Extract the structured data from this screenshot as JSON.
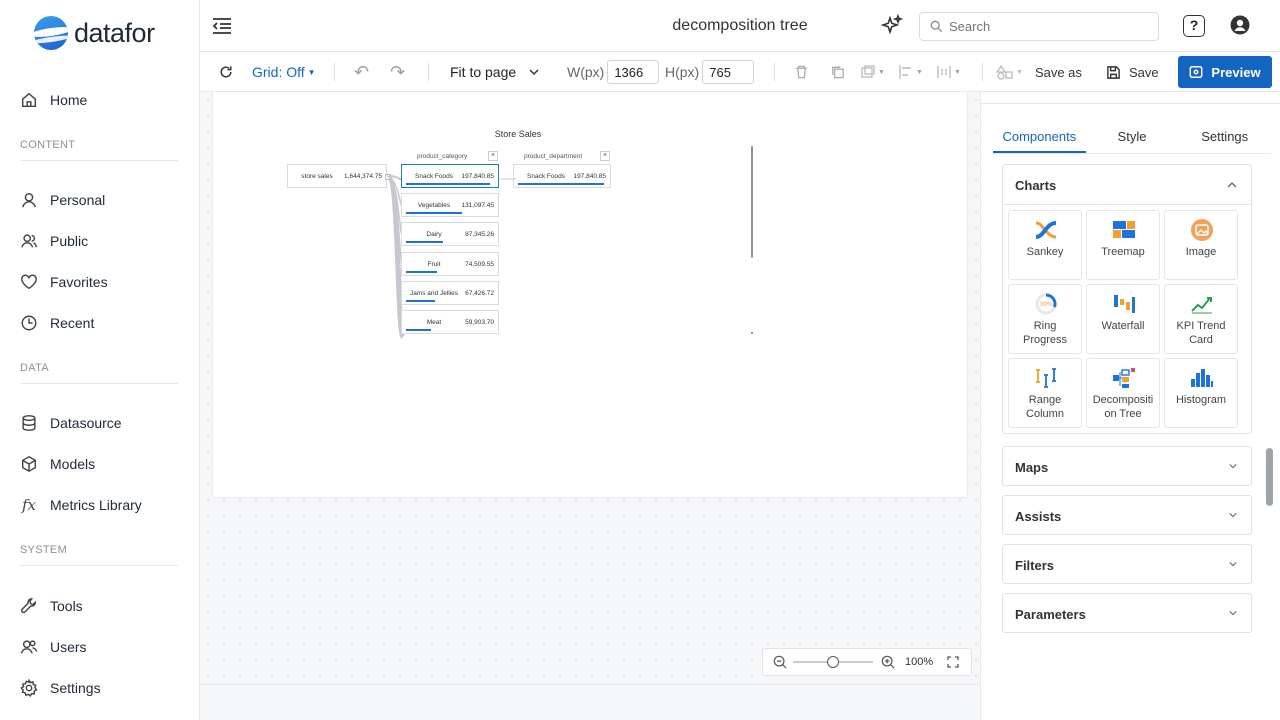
{
  "brand": {
    "name": "datafor"
  },
  "sidebar": {
    "items": [
      {
        "label": "Home",
        "icon": "home-icon"
      },
      {
        "label": "Personal",
        "icon": "user-icon"
      },
      {
        "label": "Public",
        "icon": "users-icon"
      },
      {
        "label": "Favorites",
        "icon": "heart-icon"
      },
      {
        "label": "Recent",
        "icon": "clock-icon"
      },
      {
        "label": "Datasource",
        "icon": "database-icon"
      },
      {
        "label": "Models",
        "icon": "cube-icon"
      },
      {
        "label": "Metrics Library",
        "icon": "fx-icon"
      },
      {
        "label": "Tools",
        "icon": "wrench-icon"
      },
      {
        "label": "Users",
        "icon": "people-icon"
      },
      {
        "label": "Settings",
        "icon": "gear-icon"
      }
    ],
    "sections": {
      "content": "CONTENT",
      "data": "DATA",
      "system": "SYSTEM"
    }
  },
  "header": {
    "title": "decomposition tree",
    "search_placeholder": "Search"
  },
  "toolbar": {
    "grid": "Grid: Off",
    "fit": "Fit to page",
    "w_label": "W(px)",
    "w_value": "1366",
    "h_label": "H(px)",
    "h_value": "765",
    "save_as": "Save as",
    "save": "Save",
    "preview": "Preview"
  },
  "canvas": {
    "zoom": "100%"
  },
  "chart": {
    "title": "Store Sales",
    "root": {
      "name": "store sales",
      "value": "1,644,374.75"
    },
    "level1_header": "product_category",
    "level2_header": "product_department",
    "level1": [
      {
        "name": "Snack Foods",
        "value": "197,840.85",
        "share": 0.93
      },
      {
        "name": "Vegetables",
        "value": "131,097.45",
        "share": 0.62
      },
      {
        "name": "Dairy",
        "value": "87,345.26",
        "share": 0.41
      },
      {
        "name": "Fruit",
        "value": "74,509.55",
        "share": 0.35
      },
      {
        "name": "Jams and Jellies",
        "value": "67,426.72",
        "share": 0.32
      },
      {
        "name": "Meat",
        "value": "59,903.70",
        "share": 0.28
      }
    ],
    "level2": [
      {
        "name": "Snack Foods",
        "value": "197,840.85",
        "share": 0.96
      }
    ]
  },
  "panel": {
    "tabs": [
      "Components",
      "Style",
      "Settings"
    ],
    "groups": {
      "charts": "Charts",
      "maps": "Maps",
      "assists": "Assists",
      "filters": "Filters",
      "parameters": "Parameters"
    },
    "components": [
      {
        "label": "Sankey",
        "icon": "sankey-icon"
      },
      {
        "label": "Treemap",
        "icon": "treemap-icon"
      },
      {
        "label": "Image",
        "icon": "image-icon"
      },
      {
        "label": "Ring Progress",
        "icon": "ring-progress-icon",
        "ring_text": "30%"
      },
      {
        "label": "Waterfall",
        "icon": "waterfall-icon"
      },
      {
        "label": "KPI Trend Card",
        "icon": "kpi-trend-icon"
      },
      {
        "label": "Range Column",
        "icon": "range-column-icon"
      },
      {
        "label": "Decompositi on Tree",
        "icon": "decomposition-tree-icon"
      },
      {
        "label": "Histogram",
        "icon": "histogram-icon"
      }
    ]
  }
}
